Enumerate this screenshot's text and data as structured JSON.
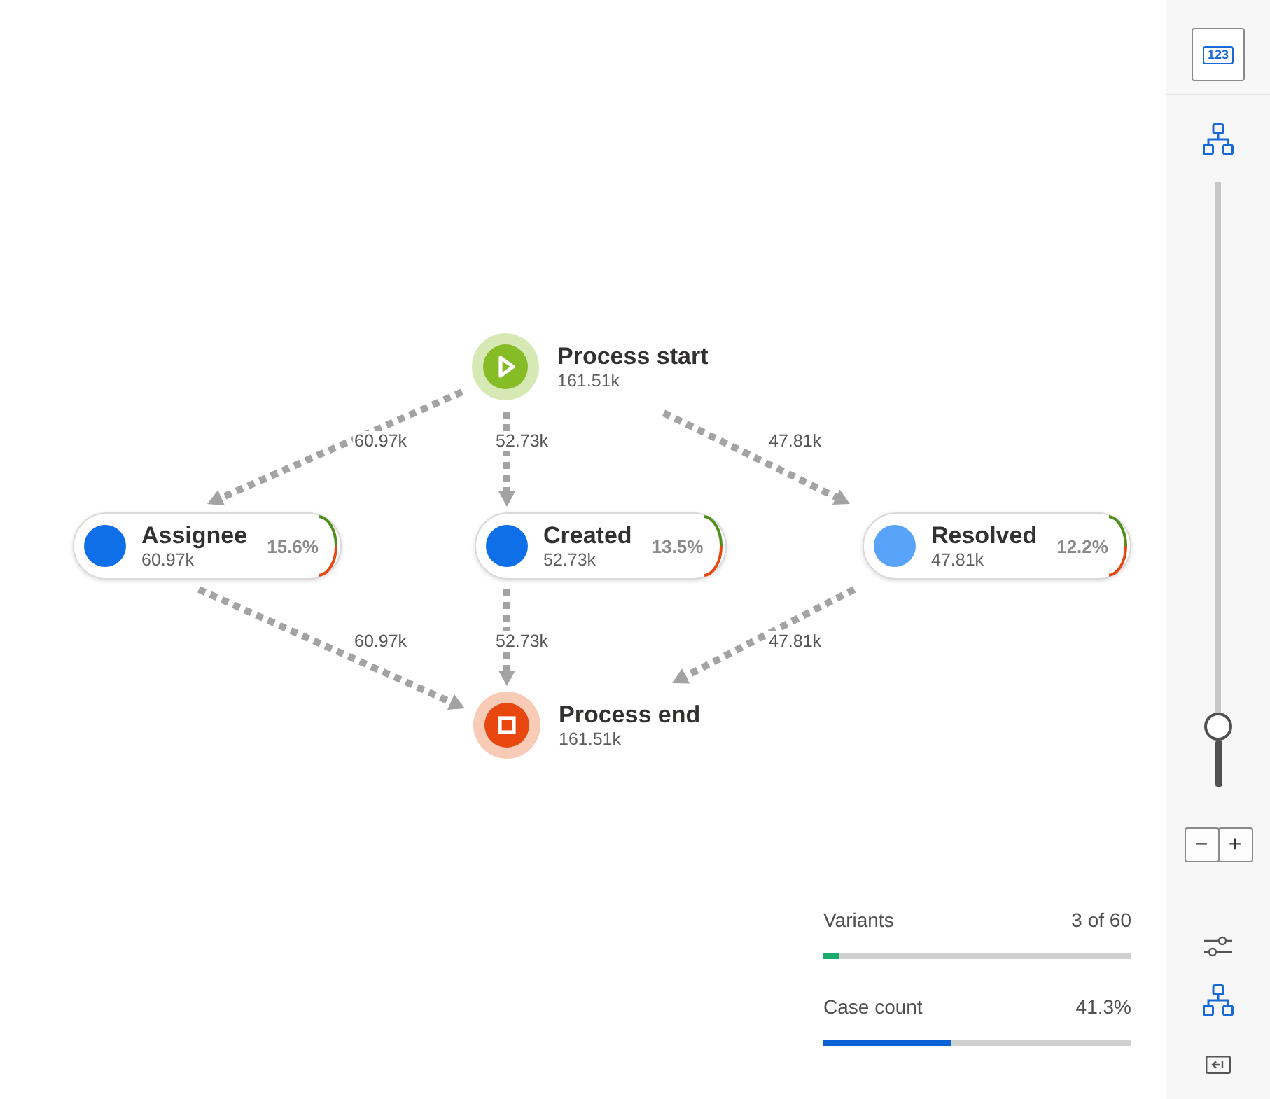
{
  "process_map": {
    "nodes": [
      {
        "kind": "start",
        "title": "Process start",
        "count": "161.51k"
      },
      {
        "kind": "activity",
        "title": "Assignee",
        "count": "60.97k",
        "share": "15.6%",
        "color": "#0f6fe8",
        "in_edge": {
          "label": "60.97k"
        },
        "out_edge": {
          "label": "60.97k"
        }
      },
      {
        "kind": "activity",
        "title": "Created",
        "count": "52.73k",
        "share": "13.5%",
        "color": "#0f6fe8",
        "in_edge": {
          "label": "52.73k"
        },
        "out_edge": {
          "label": "52.73k"
        }
      },
      {
        "kind": "activity",
        "title": "Resolved",
        "count": "47.81k",
        "share": "12.2%",
        "color": "#5aa3fb",
        "in_edge": {
          "label": "47.81k"
        },
        "out_edge": {
          "label": "47.81k"
        }
      },
      {
        "kind": "end",
        "title": "Process end",
        "count": "161.51k"
      }
    ]
  },
  "metrics": [
    {
      "label": "Variants",
      "value": "3 of 60",
      "level": 0.05,
      "color": "#1aab6a"
    },
    {
      "label": "Case count",
      "value": "41.3%",
      "level": 0.413,
      "color": "#0a63d6"
    }
  ],
  "toolbar": {
    "numbers_button": {
      "label": "123"
    },
    "zoom": {
      "level": 0.1
    },
    "zoom_out": {
      "label": "−"
    },
    "zoom_in": {
      "label": "+"
    }
  }
}
